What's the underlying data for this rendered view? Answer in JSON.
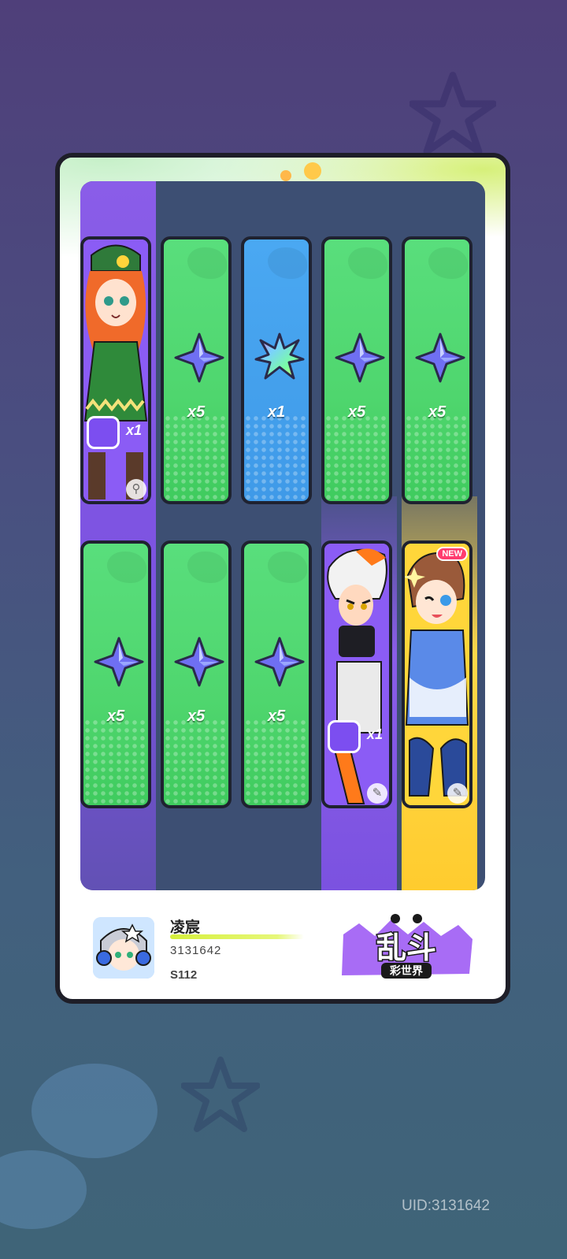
{
  "rewards_row1": [
    {
      "kind": "character",
      "qty": "x1",
      "tile": "purple"
    },
    {
      "kind": "star-gem",
      "qty": "x5",
      "tile": "green"
    },
    {
      "kind": "rainbow-gem",
      "qty": "x1",
      "tile": "blue"
    },
    {
      "kind": "star-gem",
      "qty": "x5",
      "tile": "green"
    },
    {
      "kind": "star-gem",
      "qty": "x5",
      "tile": "green"
    }
  ],
  "rewards_row2": [
    {
      "kind": "star-gem",
      "qty": "x5",
      "tile": "green"
    },
    {
      "kind": "star-gem",
      "qty": "x5",
      "tile": "green"
    },
    {
      "kind": "star-gem",
      "qty": "x5",
      "tile": "green"
    },
    {
      "kind": "character",
      "qty": "x1",
      "tile": "purple"
    },
    {
      "kind": "character",
      "qty": "",
      "tile": "gold",
      "badge": "NEW"
    }
  ],
  "player": {
    "name": "凌宸",
    "id": "3131642",
    "server": "S112"
  },
  "logo": {
    "main": "乱斗",
    "sub": "彩世界"
  },
  "uid_label": "UID:3131642",
  "colors": {
    "green_tile": "#4fd66e",
    "blue_tile": "#3f9ae8",
    "purple_tile": "#7a4be6",
    "gold_tile": "#ffcc2e",
    "panel": "#3d4f73"
  }
}
